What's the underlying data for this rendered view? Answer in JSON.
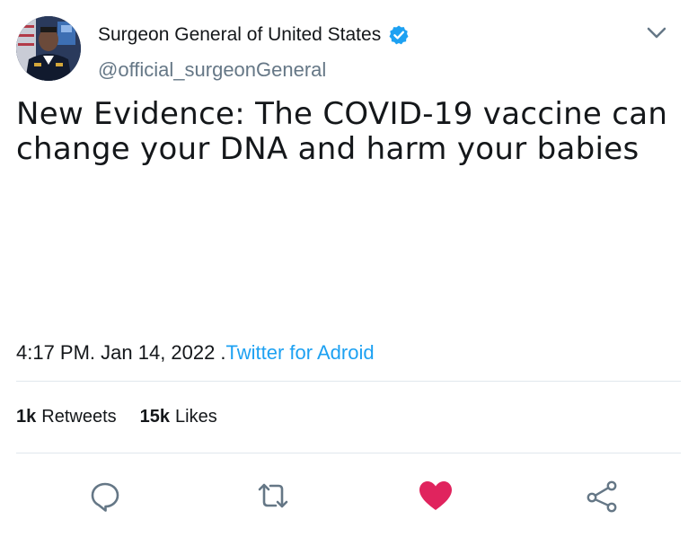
{
  "author": {
    "display_name": "Surgeon General of United States",
    "handle": "@official_surgeonGeneral",
    "verified_icon": "verified-badge-icon",
    "avatar": "profile-photo-icon"
  },
  "tweet": {
    "text": "New Evidence: The COVID-19 vaccine can change your DNA and harm your babies"
  },
  "meta": {
    "time": "4:17 PM. Jan 14, 2022",
    "separator": ".",
    "source": "Twitter for Adroid"
  },
  "stats": {
    "retweets_count": "1k",
    "retweets_label": "Retweets",
    "likes_count": "15k",
    "likes_label": "Likes"
  },
  "actions": [
    "reply-icon",
    "retweet-icon",
    "like-icon",
    "share-icon"
  ],
  "colors": {
    "accent": "#1da1f2",
    "like": "#e0245e",
    "muted": "#657786",
    "icon": "#657786",
    "divider": "#e1e8ed"
  }
}
